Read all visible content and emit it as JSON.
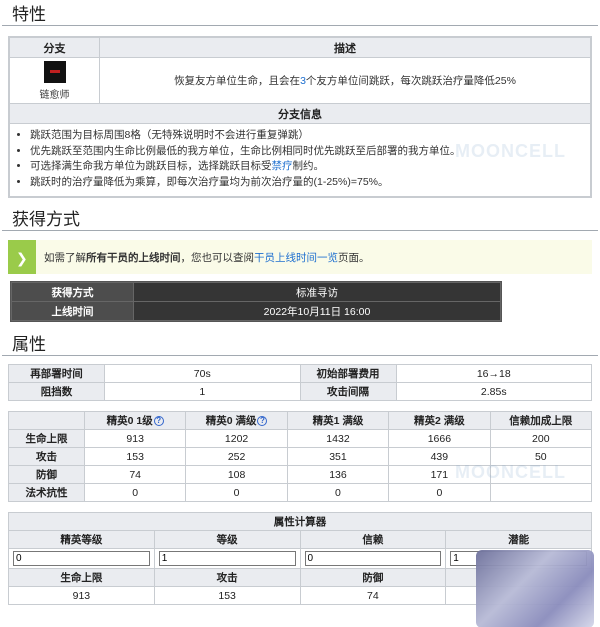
{
  "traits": {
    "title": "特性",
    "header_branch": "分支",
    "header_desc": "描述",
    "branch_name": "链愈师",
    "desc_before": "恢复友方单位生命，且会在",
    "desc_num": "3",
    "desc_after": "个友方单位间跳跃，每次跳跃治疗量降低25%",
    "branch_info_header": "分支信息",
    "info": [
      "跳跃范围为目标周围8格（无特殊说明时不会进行重复弹跳）",
      "优先跳跃至范围内生命比例最低的我方单位，生命比例相同时优先跳跃至后部署的我方单位。",
      "可选择满生命我方单位为跳跃目标，选择跳跃目标受",
      "跳跃时的治疗量降低为乘算，即每次治疗量均为前次治疗量的(1-25%)=75%。"
    ],
    "info3_link": "禁疗",
    "info3_after": "制约。"
  },
  "obtain": {
    "title": "获得方式",
    "notice_before": "如需了解",
    "notice_bold": "所有干员的上线时间",
    "notice_mid": "，您也可以查阅",
    "notice_link": "干员上线时间一览",
    "notice_after": "页面。",
    "method_label": "获得方式",
    "method_value": "标准寻访",
    "online_label": "上线时间",
    "online_value": "2022年10月11日 16:00"
  },
  "attributes": {
    "title": "属性",
    "redeploy_label": "再部署时间",
    "redeploy_value": "70s",
    "cost_label": "初始部署费用",
    "cost_value": "16→18",
    "block_label": "阻挡数",
    "block_value": "1",
    "interval_label": "攻击间隔",
    "interval_value": "2.85s",
    "stats_headers": [
      "精英0 1级",
      "精英0 满级",
      "精英1 满级",
      "精英2 满级",
      "信赖加成上限"
    ],
    "stats_rows": [
      {
        "label": "生命上限",
        "values": [
          "913",
          "1202",
          "1432",
          "1666",
          "200"
        ]
      },
      {
        "label": "攻击",
        "values": [
          "153",
          "252",
          "351",
          "439",
          "50"
        ]
      },
      {
        "label": "防御",
        "values": [
          "74",
          "108",
          "136",
          "171",
          ""
        ]
      },
      {
        "label": "法术抗性",
        "values": [
          "0",
          "0",
          "0",
          "0",
          ""
        ]
      }
    ],
    "calc_title": "属性计算器",
    "calc_headers": [
      "精英等级",
      "等级",
      "信赖",
      "潜能"
    ],
    "calc_inputs": [
      "0",
      "1",
      "0",
      "1"
    ],
    "calc_result_headers": [
      "生命上限",
      "攻击",
      "防御",
      ""
    ],
    "calc_results": [
      "913",
      "153",
      "74",
      ""
    ]
  },
  "watermark": "MOONCELL"
}
